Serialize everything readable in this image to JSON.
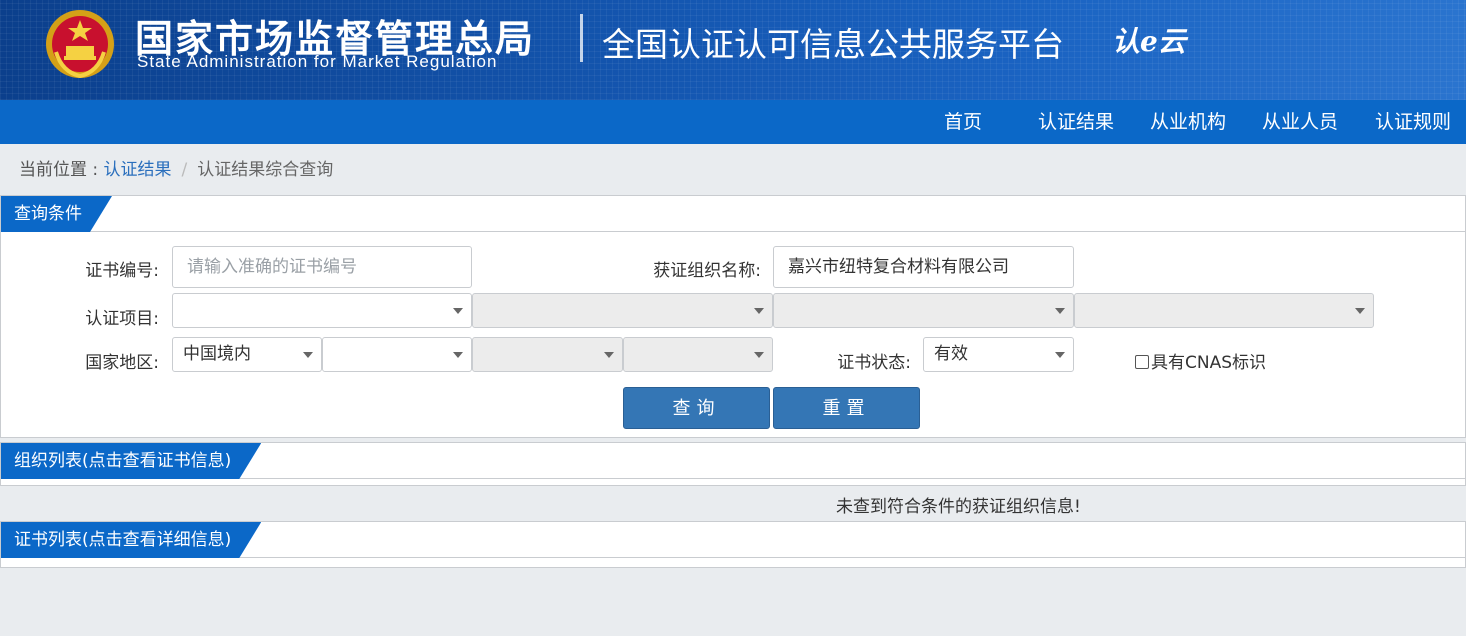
{
  "header": {
    "agency_cn": "国家市场监督管理总局",
    "agency_en": "State Administration  for  Market Regulation",
    "platform_title": "全国认证认可信息公共服务平台",
    "cloud_logo": "认e云",
    "accent_color": "#0b68c8"
  },
  "nav": {
    "items": [
      {
        "label": "首页"
      },
      {
        "label": "认证结果"
      },
      {
        "label": "从业机构"
      },
      {
        "label": "从业人员"
      },
      {
        "label": "认证规则"
      }
    ]
  },
  "breadcrumb": {
    "prefix": "当前位置 : ",
    "link": "认证结果",
    "separator": "/",
    "current": "认证结果综合查询"
  },
  "query_panel": {
    "title": "查询条件",
    "cert_no_label": "证书编号:",
    "cert_no_placeholder": "请输入准确的证书编号",
    "org_name_label": "获证组织名称:",
    "org_name_value": "嘉兴市纽特复合材料有限公司",
    "cert_project_label": "认证项目:",
    "region_label": "国家地区:",
    "region_value": "中国境内",
    "cert_status_label": "证书状态:",
    "cert_status_value": "有效",
    "cnas_label": "具有CNAS标识",
    "query_button": "查询",
    "reset_button": "重置"
  },
  "org_panel": {
    "title": "组织列表(点击查看证书信息)",
    "empty_message": "未查到符合条件的获证组织信息!"
  },
  "cert_panel": {
    "title": "证书列表(点击查看详细信息)"
  }
}
